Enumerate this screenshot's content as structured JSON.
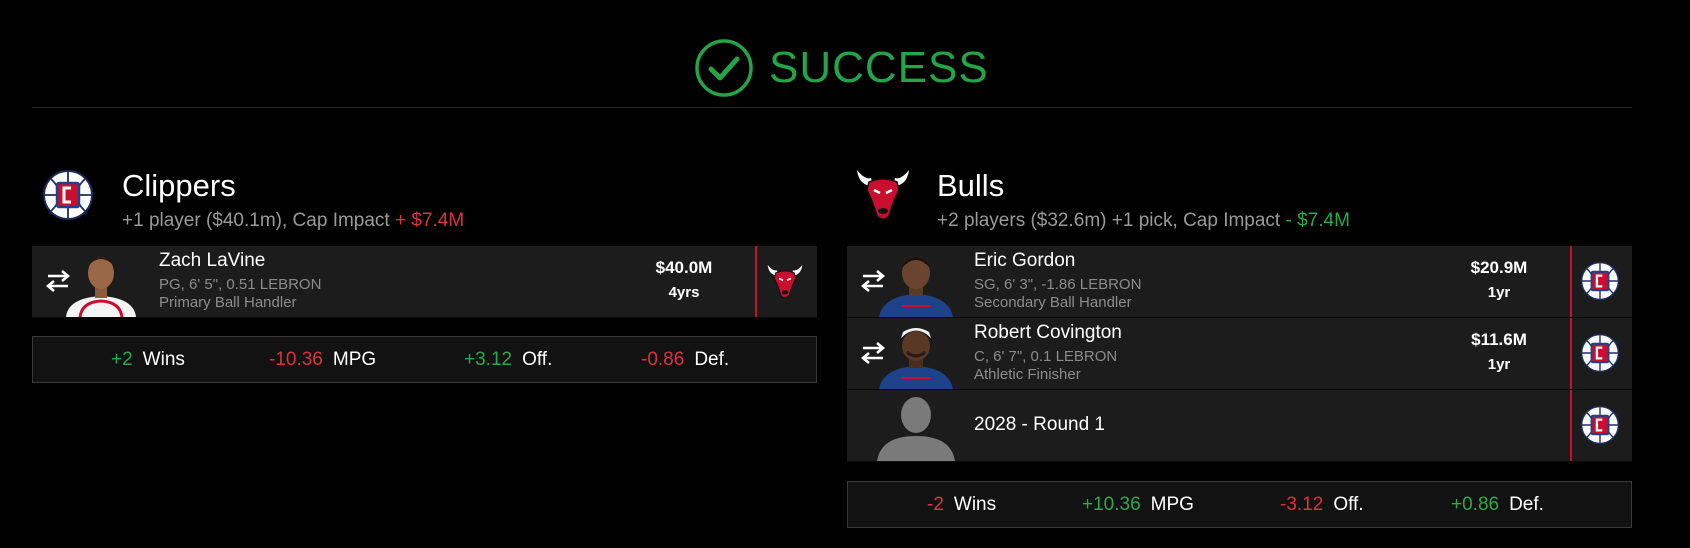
{
  "header": {
    "title": "SUCCESS",
    "icon": "check-circle-icon",
    "color": "#22a447"
  },
  "left_team": {
    "name": "Clippers",
    "logo": "clippers-logo",
    "summary": "+1 player ($40.1m), Cap Impact",
    "cap_impact": "+ $7.4M",
    "players": [
      {
        "name": "Zach LaVine",
        "line1": "PG, 6' 5\", 0.51 LEBRON",
        "line2": "Primary Ball Handler",
        "salary": "$40.0M",
        "years": "4yrs",
        "destination_logo": "bulls-logo"
      }
    ],
    "stats": [
      {
        "value": "+2",
        "label": "Wins"
      },
      {
        "value": "-10.36",
        "label": "MPG"
      },
      {
        "value": "+3.12",
        "label": "Off."
      },
      {
        "value": "-0.86",
        "label": "Def."
      }
    ]
  },
  "right_team": {
    "name": "Bulls",
    "logo": "bulls-logo",
    "summary": "+2 players ($32.6m) +1 pick, Cap Impact",
    "cap_impact": "- $7.4M",
    "players": [
      {
        "name": "Eric Gordon",
        "line1": "SG, 6' 3\", -1.86 LEBRON",
        "line2": "Secondary Ball Handler",
        "salary": "$20.9M",
        "years": "1yr",
        "destination_logo": "clippers-logo"
      },
      {
        "name": "Robert Covington",
        "line1": "C, 6' 7\", 0.1 LEBRON",
        "line2": "Athletic Finisher",
        "salary": "$11.6M",
        "years": "1yr",
        "destination_logo": "clippers-logo"
      }
    ],
    "pick": {
      "name": "2028 - Round 1",
      "destination_logo": "clippers-logo"
    },
    "stats": [
      {
        "value": "-2",
        "label": "Wins"
      },
      {
        "value": "+10.36",
        "label": "MPG"
      },
      {
        "value": "-3.12",
        "label": "Off."
      },
      {
        "value": "+0.86",
        "label": "Def."
      }
    ]
  },
  "colors": {
    "positive": "#2ba84a",
    "negative": "#e0303d",
    "trade_line": "#c8102e"
  }
}
